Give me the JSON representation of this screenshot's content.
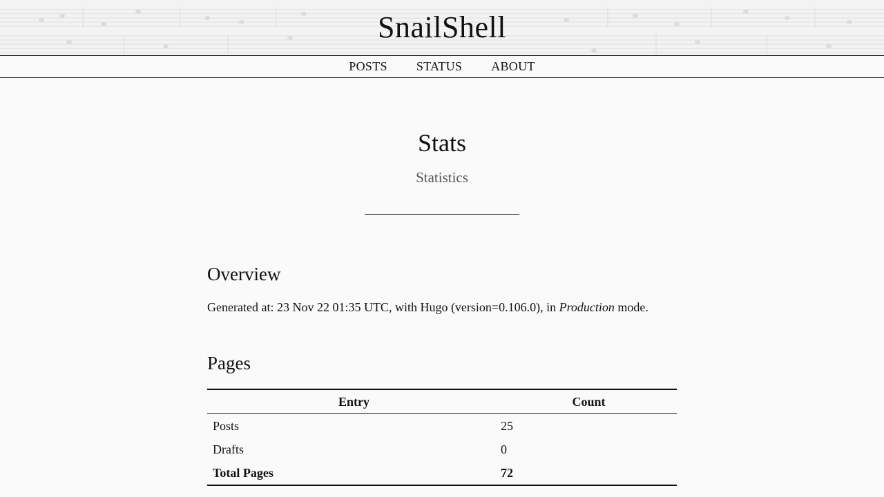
{
  "site": {
    "title": "SnailShell"
  },
  "nav": {
    "items": [
      {
        "label": "POSTS"
      },
      {
        "label": "STATUS"
      },
      {
        "label": "ABOUT"
      }
    ]
  },
  "page": {
    "title": "Stats",
    "subtitle": "Statistics"
  },
  "overview": {
    "heading": "Overview",
    "text_before": "Generated at: 23 Nov 22 01:35 UTC, with Hugo (version=0.106.0), in ",
    "mode": "Production",
    "text_after": " mode."
  },
  "pages": {
    "heading": "Pages",
    "columns": [
      "Entry",
      "Count"
    ],
    "rows": [
      {
        "entry": "Posts",
        "count": "25"
      },
      {
        "entry": "Drafts",
        "count": "0"
      },
      {
        "entry": "Total Pages",
        "count": "72"
      }
    ]
  },
  "colors": {
    "background": "#fafafa",
    "header_background": "#f3f3f3",
    "text": "#111111",
    "subtitle": "#555555"
  }
}
